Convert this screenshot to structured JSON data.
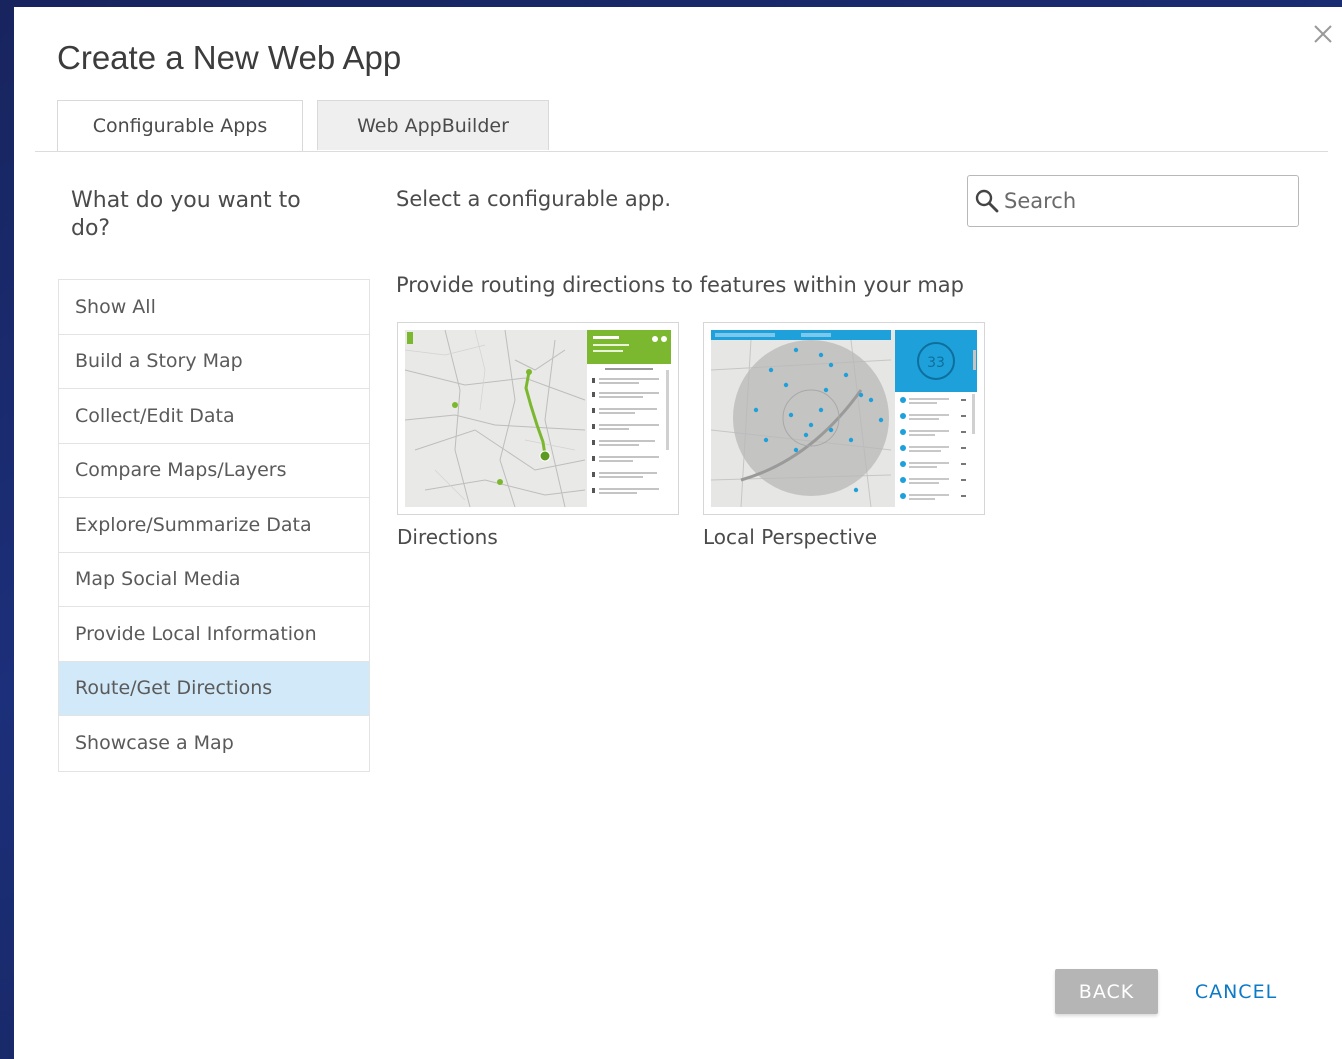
{
  "dialog": {
    "title": "Create a New Web App"
  },
  "tabs": [
    {
      "label": "Configurable Apps",
      "active": true
    },
    {
      "label": "Web AppBuilder",
      "active": false
    }
  ],
  "sidebar": {
    "question": "What do you want to do?",
    "items": [
      {
        "label": "Show All"
      },
      {
        "label": "Build a Story Map"
      },
      {
        "label": "Collect/Edit Data"
      },
      {
        "label": "Compare Maps/Layers"
      },
      {
        "label": "Explore/Summarize Data"
      },
      {
        "label": "Map Social Media"
      },
      {
        "label": "Provide Local Information"
      },
      {
        "label": "Route/Get Directions",
        "selected": true
      },
      {
        "label": "Showcase a Map"
      }
    ]
  },
  "main": {
    "subtitle": "Select a configurable app.",
    "search": {
      "placeholder": "Search",
      "value": ""
    },
    "group_heading": "Provide routing directions to features within your map",
    "apps": [
      {
        "title": "Directions",
        "thumbnail": "directions-map-preview"
      },
      {
        "title": "Local Perspective",
        "thumbnail": "local-perspective-map-preview"
      }
    ]
  },
  "footer": {
    "back_label": "BACK",
    "cancel_label": "CANCEL"
  },
  "colors": {
    "selected_bg": "#d2e9f9",
    "accent_blue": "#0d7ac8",
    "disabled_button": "#b5b5b5",
    "directions_green": "#7cb82f",
    "local_blue": "#1ea0da"
  },
  "icons": {
    "close": "close-icon",
    "search": "search-icon"
  }
}
